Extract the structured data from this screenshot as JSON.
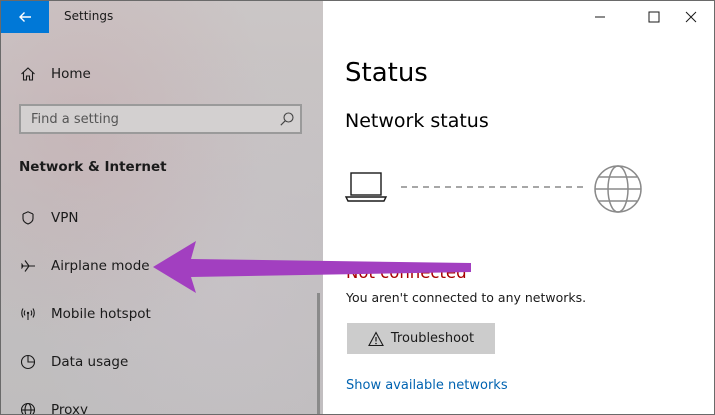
{
  "window": {
    "title": "Settings",
    "controls": [
      "minimize",
      "maximize",
      "close"
    ]
  },
  "sidebar": {
    "home_label": "Home",
    "search": {
      "placeholder": "Find a setting",
      "value": ""
    },
    "section_title": "Network & Internet",
    "items": [
      {
        "label": "VPN",
        "icon": "vpn-icon"
      },
      {
        "label": "Airplane mode",
        "icon": "airplane-icon"
      },
      {
        "label": "Mobile hotspot",
        "icon": "hotspot-icon"
      },
      {
        "label": "Data usage",
        "icon": "data-usage-icon"
      },
      {
        "label": "Proxy",
        "icon": "globe-icon"
      }
    ]
  },
  "main": {
    "page_title": "Status",
    "section_heading": "Network status",
    "status": "Not connected",
    "status_description": "You aren't connected to any networks.",
    "troubleshoot_label": "Troubleshoot",
    "show_networks_link": "Show available networks"
  },
  "colors": {
    "accent": "#0078d7",
    "status_error": "#a80000",
    "link": "#0063b1",
    "annotation_arrow": "#a23fc0"
  }
}
